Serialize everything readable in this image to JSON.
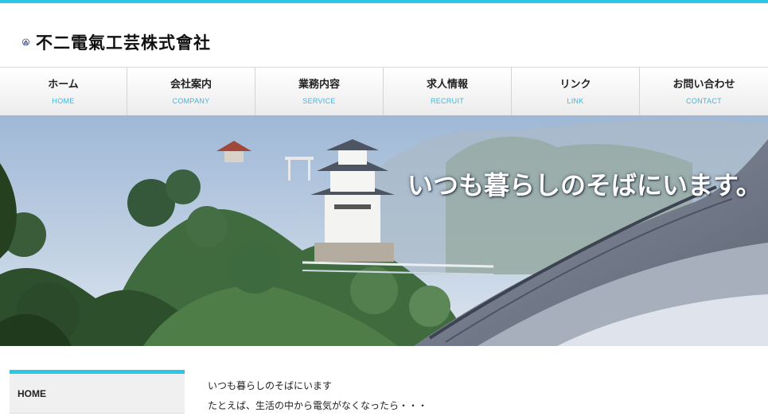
{
  "header": {
    "company_name": "不二電氣工芸株式會社",
    "logo_icon": "mountain-in-circle-logo"
  },
  "nav": [
    {
      "label": "ホーム",
      "sub": "HOME"
    },
    {
      "label": "会社案内",
      "sub": "COMPANY"
    },
    {
      "label": "業務内容",
      "sub": "SERVICE"
    },
    {
      "label": "求人情報",
      "sub": "RECRUIT"
    },
    {
      "label": "リンク",
      "sub": "LINK"
    },
    {
      "label": "お問い合わせ",
      "sub": "CONTACT"
    }
  ],
  "hero": {
    "catchphrase": "いつも暮らしのそばにいます。"
  },
  "sidebar": {
    "items": [
      {
        "label": "HOME"
      }
    ]
  },
  "main": {
    "lines": [
      "いつも暮らしのそばにいます",
      "たとえば、生活の中から電気がなくなったら・・・"
    ]
  },
  "colors": {
    "accent": "#2ec6e6",
    "nav_sub": "#3cb6de"
  }
}
